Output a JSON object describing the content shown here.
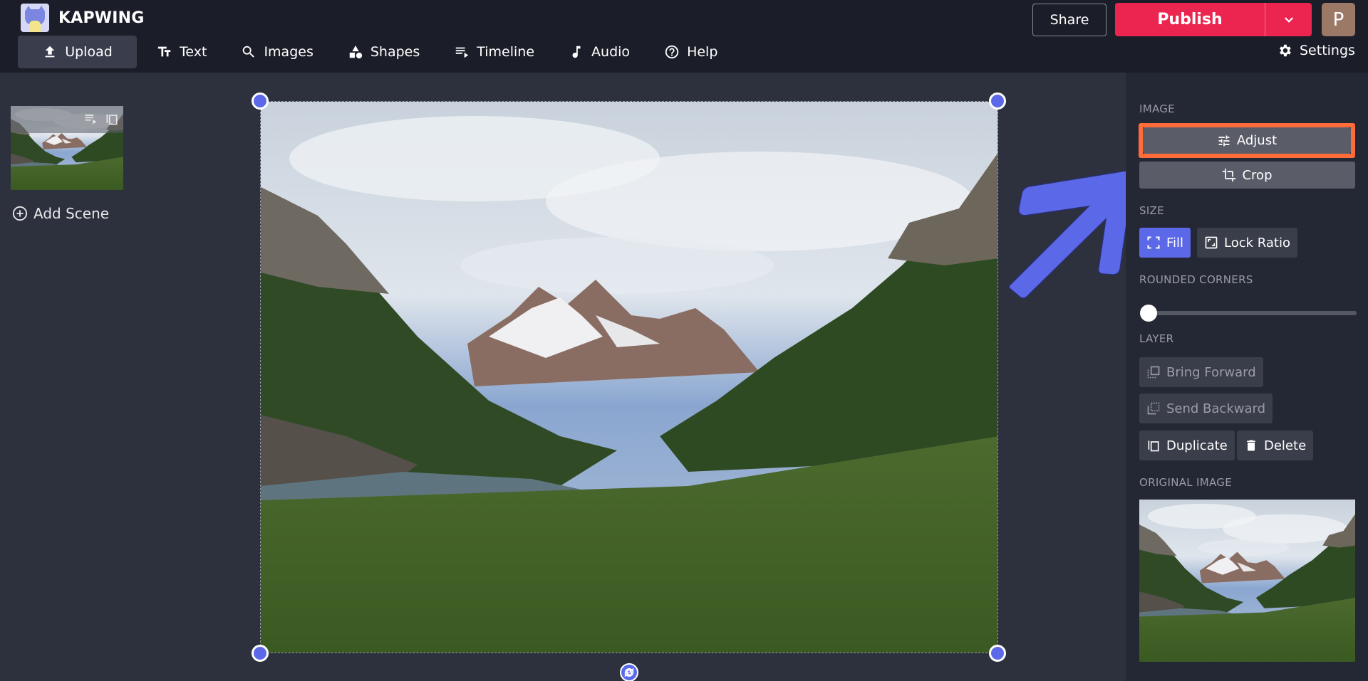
{
  "header": {
    "brand": "KAPWING",
    "share_label": "Share",
    "publish_label": "Publish",
    "avatar_initial": "P",
    "settings_label": "Settings"
  },
  "nav": [
    {
      "label": "Upload",
      "icon": "upload-icon",
      "active": true
    },
    {
      "label": "Text",
      "icon": "text-icon"
    },
    {
      "label": "Images",
      "icon": "search-icon"
    },
    {
      "label": "Shapes",
      "icon": "shapes-icon"
    },
    {
      "label": "Timeline",
      "icon": "timeline-icon"
    },
    {
      "label": "Audio",
      "icon": "music-note-icon"
    },
    {
      "label": "Help",
      "icon": "help-icon"
    }
  ],
  "scenes": {
    "add_scene_label": "Add Scene"
  },
  "panel": {
    "image_label": "IMAGE",
    "adjust_label": "Adjust",
    "crop_label": "Crop",
    "size_label": "SIZE",
    "fill_label": "Fill",
    "lock_ratio_label": "Lock Ratio",
    "rounded_corners_label": "ROUNDED CORNERS",
    "rounded_corners_value": 0,
    "layer_label": "LAYER",
    "bring_forward_label": "Bring Forward",
    "send_backward_label": "Send Backward",
    "duplicate_label": "Duplicate",
    "delete_label": "Delete",
    "original_image_label": "ORIGINAL IMAGE"
  },
  "colors": {
    "accent": "#5b69e8",
    "publish": "#ec2450",
    "highlight": "#ff6b39"
  }
}
